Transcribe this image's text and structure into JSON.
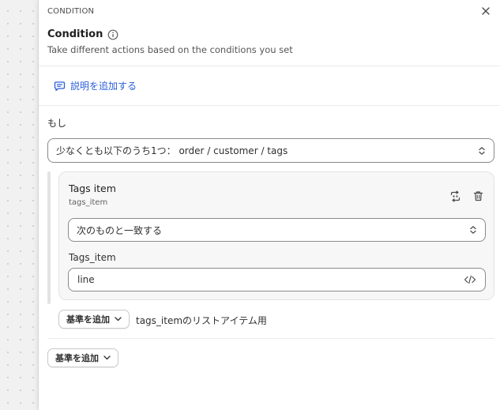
{
  "header": {
    "eyebrow": "CONDITION",
    "title": "Condition",
    "subtitle": "Take different actions based on the conditions you set"
  },
  "description": {
    "add_label": "説明を追加する"
  },
  "condition": {
    "if_label": "もし",
    "selector_value": "少なくとも以下のうち1つ： order / customer / tags"
  },
  "criterion": {
    "title": "Tags item",
    "subtitle": "tags_item",
    "operator_value": "次のものと一致する",
    "field_label": "Tags_item",
    "field_value": "line"
  },
  "actions": {
    "inner_add_label": "基準を追加",
    "list_note": "tags_itemのリストアイテム用",
    "outer_add_label": "基準を追加"
  },
  "colors": {
    "accent": "#2b5fd9",
    "border": "#8a8a8a",
    "card_bg": "#f7f7f7"
  },
  "icons": {
    "close": "close-icon",
    "info": "info-icon",
    "chat": "chat-plus-icon",
    "chevron_updown": "chevron-updown-icon",
    "swap": "swap-icon",
    "delete": "trash-icon",
    "code": "code-icon",
    "chevron_down": "chevron-down-icon"
  }
}
